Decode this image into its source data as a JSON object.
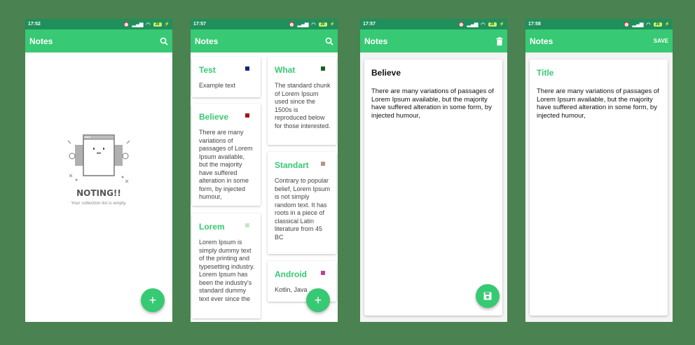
{
  "screens": [
    {
      "status": {
        "time": "17:52",
        "battery": "29"
      },
      "appbar": {
        "title": "Notes",
        "action_icon": "search-icon"
      },
      "empty": {
        "title": "NOTING!!",
        "subtitle": "Your collection list is empty."
      },
      "fab_icon": "plus-icon"
    },
    {
      "status": {
        "time": "17:57",
        "battery": "29"
      },
      "appbar": {
        "title": "Notes",
        "action_icon": "search-icon"
      },
      "notes": [
        {
          "title": "Test",
          "color": "#1a237e",
          "body": "Example text"
        },
        {
          "title": "Believe",
          "color": "#a01818",
          "body": "There are many variations of passages of Lorem Ipsum available, but the majority have suffered alteration in some form, by injected humour,"
        },
        {
          "title": "Lorem",
          "color": "#c8e6c9",
          "body": "Lorem Ipsum is simply dummy text of the printing and typesetting industry. Lorem Ipsum has been the industry's standard dummy text ever since the"
        },
        {
          "title": "What",
          "color": "#1b5e20",
          "body": "The standard chunk of Lorem Ipsum used since the 1500s is reproduced below for those interested."
        },
        {
          "title": "Standart",
          "color": "#bc8f8f",
          "body": "Contrary to popular belief, Lorem Ipsum is not simply random text. It has roots in a piece of classical Latin literature from 45 BC"
        },
        {
          "title": "Android",
          "color": "#c0409a",
          "body": "Kotlin, Java"
        }
      ],
      "fab_icon": "plus-icon"
    },
    {
      "status": {
        "time": "17:57",
        "battery": "29"
      },
      "appbar": {
        "title": "Notes",
        "action_icon": "trash-icon"
      },
      "note": {
        "title": "Believe",
        "body": "There are many variations of passages of Lorem Ipsum available, but the majority have suffered alteration in some form, by injected humour,"
      },
      "fab_icon": "save-icon"
    },
    {
      "status": {
        "time": "17:58",
        "battery": "29"
      },
      "appbar": {
        "title": "Notes",
        "action_label": "SAVE"
      },
      "note": {
        "title_placeholder": "Title",
        "body": "There are many variations of passages of Lorem Ipsum available, but the majority have suffered alteration in some form, by injected humour,"
      }
    }
  ],
  "colors": {
    "primary": "#37c973",
    "status_bar": "#1f8f5c",
    "background": "#4a8251"
  }
}
